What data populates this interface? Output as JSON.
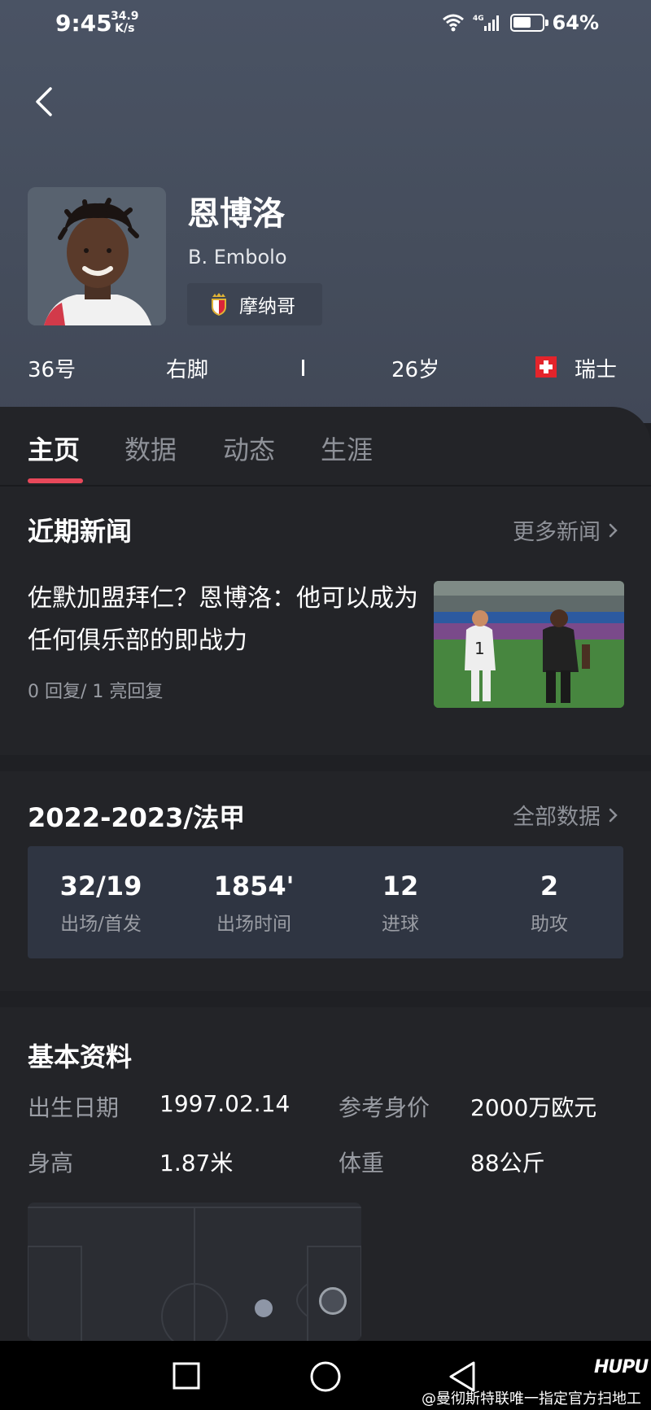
{
  "status_bar": {
    "time": "9:45",
    "speed_value": "34.9",
    "speed_unit": "K/s",
    "network": "4G",
    "battery_percent": "64%",
    "battery_level": 0.64
  },
  "header": {
    "back_icon": "chevron-left-icon"
  },
  "player": {
    "name": "恩博洛",
    "name_en": "B. Embolo",
    "club": "摩纳哥",
    "club_icon": "monaco-crest-icon",
    "number": "36号",
    "foot": "右脚",
    "age": "26岁",
    "nationality": "瑞士",
    "flag_icon": "switzerland-flag-icon"
  },
  "tabs": [
    {
      "label": "主页",
      "active": true
    },
    {
      "label": "数据",
      "active": false
    },
    {
      "label": "动态",
      "active": false
    },
    {
      "label": "生涯",
      "active": false
    }
  ],
  "news": {
    "title": "近期新闻",
    "more": "更多新闻",
    "item": {
      "headline": "佐默加盟拜仁？恩博洛：他可以成为任何俱乐部的即战力",
      "meta": "0 回复/ 1 亮回复"
    }
  },
  "stats": {
    "season": "2022-2023/法甲",
    "more": "全部数据",
    "items": [
      {
        "value": "32/19",
        "label": "出场/首发"
      },
      {
        "value": "1854'",
        "label": "出场时间"
      },
      {
        "value": "12",
        "label": "进球"
      },
      {
        "value": "2",
        "label": "助攻"
      }
    ]
  },
  "basic": {
    "title": "基本资料",
    "birth_label": "出生日期",
    "birth_value": "1997.02.14",
    "value_label": "参考身价",
    "value_value": "2000万欧元",
    "height_label": "身高",
    "height_value": "1.87米",
    "weight_label": "体重",
    "weight_value": "88公斤"
  },
  "nav": {
    "recent_icon": "square-icon",
    "home_icon": "circle-icon",
    "back_icon": "triangle-back-icon"
  },
  "watermark": {
    "logo": "HUPU",
    "text": "@曼彻斯特联唯一指定官方扫地工"
  },
  "colors": {
    "accent": "#e8485a",
    "hero_bg": "#4a5364",
    "card_bg": "#232428"
  }
}
